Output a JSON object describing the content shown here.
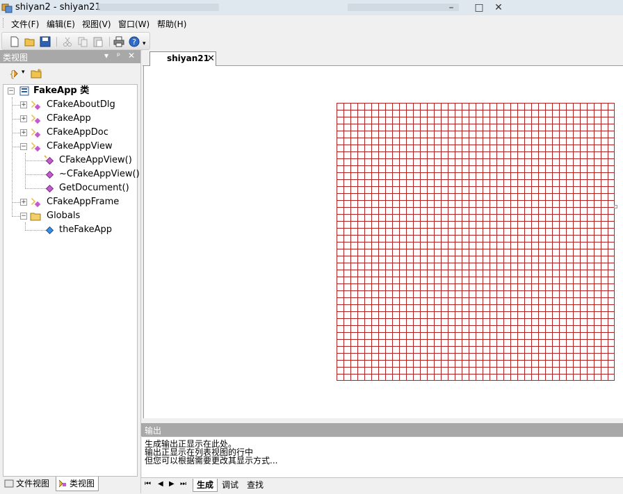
{
  "window": {
    "title": "shiyan2 - shiyan21"
  },
  "menu": [
    "文件(F)",
    "编辑(E)",
    "视图(V)",
    "窗口(W)",
    "帮助(H)"
  ],
  "left_pane": {
    "title": "类视图",
    "tree": [
      {
        "label": "FakeApp 类",
        "bold": true
      },
      {
        "label": "CFakeAboutDlg"
      },
      {
        "label": "CFakeApp"
      },
      {
        "label": "CFakeAppDoc"
      },
      {
        "label": "CFakeAppView"
      },
      {
        "label": "CFakeAppView()"
      },
      {
        "label": "~CFakeAppView()"
      },
      {
        "label": "GetDocument()"
      },
      {
        "label": "CFakeAppFrame"
      },
      {
        "label": "Globals"
      },
      {
        "label": "theFakeApp"
      }
    ],
    "bottom_tabs": [
      "文件视图",
      "类视图"
    ]
  },
  "document": {
    "tab_label": "shiyan21",
    "grid": {
      "color": "#b22222",
      "rows": 40,
      "cols": 40
    }
  },
  "output": {
    "title": "输出",
    "lines": [
      "生成输出正显示在此处。",
      "输出正显示在列表视图的行中",
      "但您可以根据需要更改其显示方式..."
    ],
    "tabs": [
      "生成",
      "调试",
      "查找"
    ]
  },
  "colors": {
    "pane_header": "#a8a8a8",
    "grid_line": "#b22222"
  }
}
